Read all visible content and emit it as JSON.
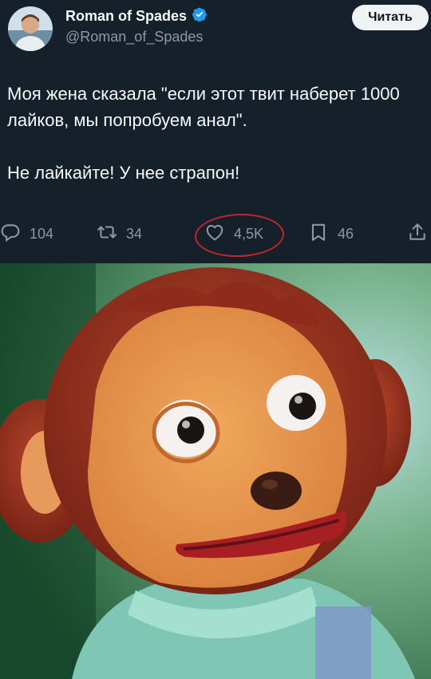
{
  "tweet": {
    "author_name": "Roman of Spades",
    "handle": "@Roman_of_Spades",
    "follow_label": "Читать",
    "text": "Моя жена сказала \"если этот твит наберет 1000 лайков, мы попробуем анал\".\n\nНе лайкайте! У нее страпон!",
    "replies": "104",
    "retweets": "34",
    "likes": "4,5K",
    "bookmarks": "46",
    "verified_color": "#1d9bf0",
    "highlight_color": "#c0262b"
  },
  "icons": {
    "reply": "reply-icon",
    "retweet": "retweet-icon",
    "like": "heart-icon",
    "bookmark": "bookmark-icon",
    "share": "share-icon",
    "verified": "verified-badge-icon"
  }
}
